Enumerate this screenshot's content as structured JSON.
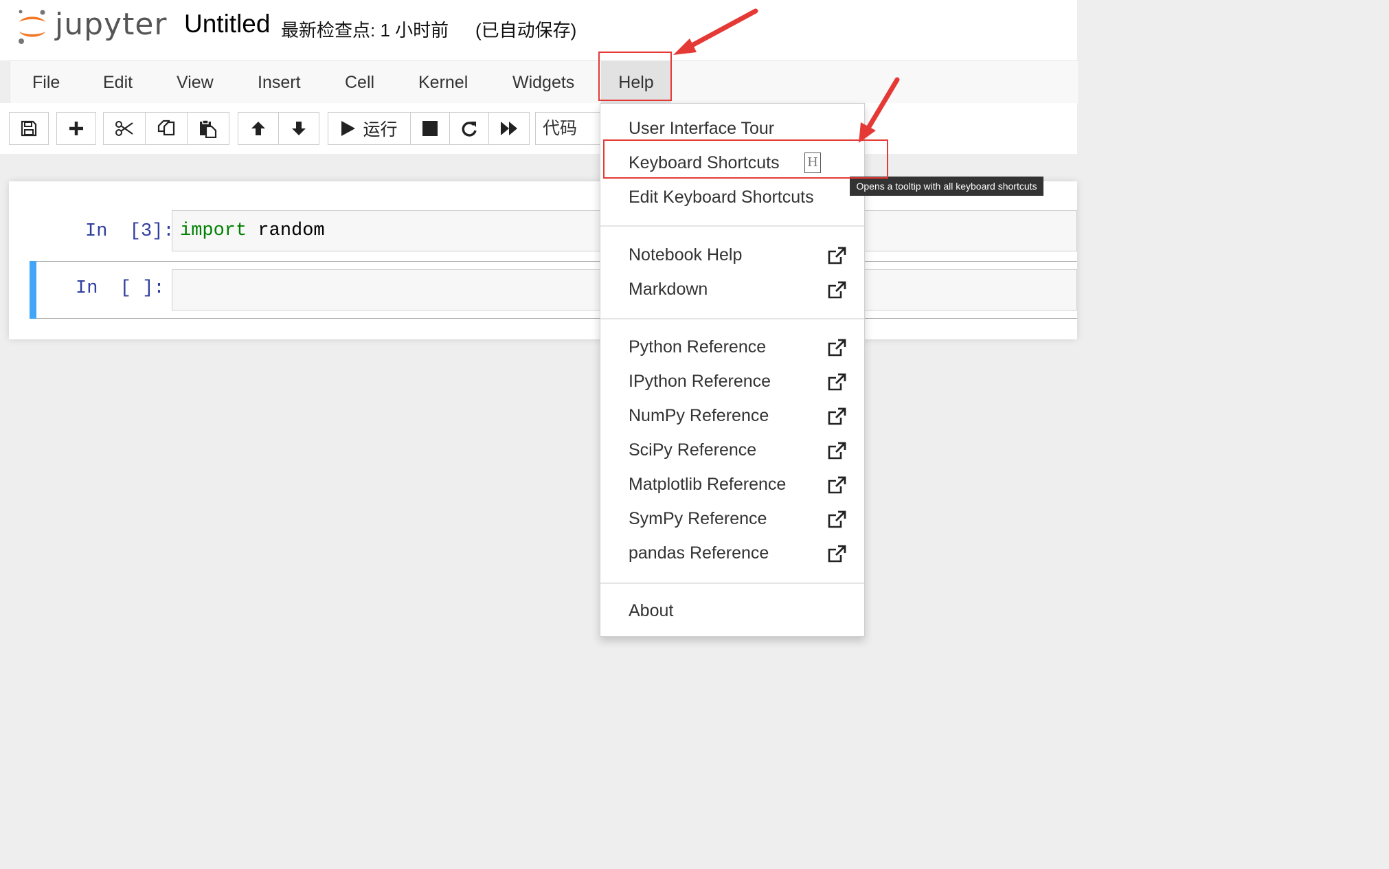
{
  "header": {
    "logo_text": "jupyter",
    "notebook_title": "Untitled",
    "checkpoint_text": "最新检查点: 1 小时前",
    "autosave_text": "(已自动保存)"
  },
  "menubar": {
    "items": [
      "File",
      "Edit",
      "View",
      "Insert",
      "Cell",
      "Kernel",
      "Widgets",
      "Help"
    ]
  },
  "toolbar": {
    "run_label": "运行",
    "cell_type": "代码",
    "icons": [
      "save-icon",
      "plus-icon",
      "scissors-icon",
      "copy-icon",
      "paste-icon",
      "arrow-up-icon",
      "arrow-down-icon",
      "play-icon",
      "stop-icon",
      "restart-icon",
      "fast-forward-icon"
    ]
  },
  "cells": [
    {
      "prompt": "In  [3]:",
      "code_keyword": "import",
      "code_rest": " random"
    },
    {
      "prompt": "In  [ ]:",
      "code_keyword": "",
      "code_rest": ""
    }
  ],
  "help_menu": {
    "items": [
      {
        "label": "User Interface Tour",
        "external": false
      },
      {
        "label": "Keyboard Shortcuts",
        "external": false,
        "shortcut": "H"
      },
      {
        "label": "Edit Keyboard Shortcuts",
        "external": false
      },
      {
        "label": "Notebook Help",
        "external": true
      },
      {
        "label": "Markdown",
        "external": true
      },
      {
        "label": "Python Reference",
        "external": true
      },
      {
        "label": "IPython Reference",
        "external": true
      },
      {
        "label": "NumPy Reference",
        "external": true
      },
      {
        "label": "SciPy Reference",
        "external": true
      },
      {
        "label": "Matplotlib Reference",
        "external": true
      },
      {
        "label": "SymPy Reference",
        "external": true
      },
      {
        "label": "pandas Reference",
        "external": true
      },
      {
        "label": "About",
        "external": false
      }
    ]
  },
  "tooltip": "Opens a tooltip with all keyboard shortcuts",
  "colors": {
    "annotation": "#e53935",
    "selected_cell_bar": "#42a5f5",
    "keyword": "#008000",
    "prompt": "#303f9f"
  }
}
